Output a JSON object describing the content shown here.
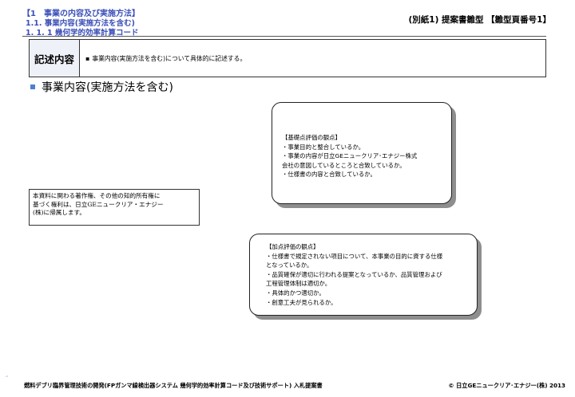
{
  "header": {
    "line1": "【1　事業の内容及び実施方法】",
    "line2": "1.1. 事業内容(実施方法を含む)",
    "line3": "1. 1. 1  幾何学的効率計算コード",
    "doc_label": "(別紙1) 提案書雛型 【雛型頁番号1】"
  },
  "summary": {
    "tag": "記述内容",
    "bullet": "▪",
    "text": "事業内容(実施方法を含む)について具体的に記述する。"
  },
  "section": {
    "heading": "事業内容(実施方法を含む)"
  },
  "callout_basic": {
    "lines": [
      "【基礎点評価の観点】",
      "・事業目的と整合しているか。",
      "・事業の内容が日立GEニュークリア･エナジー株式",
      "会社の意図しているところと合致しているか。",
      "・仕様書の内容と合致しているか。"
    ]
  },
  "callout_bonus": {
    "lines": [
      "【加点評価の観点】",
      "・仕様書で規定されない項目について、本事業の目的に資する仕様",
      "となっているか。",
      "・品質確保が適切に行われる提案となっているか、品質管理および",
      "工程管理体制は適切か。",
      "・具体的かつ適切か。",
      "・創意工夫が見られるか。"
    ]
  },
  "copyright_note": {
    "lines": [
      "本資料に関わる著作権、その他の知的所有権に",
      "基づく権利は、日立GEニュークリア・エナジー",
      "(株)に帰属します。"
    ]
  },
  "footer": {
    "left": "燃料デブリ臨界管理技術の開発(FPガンマ線検出器システム  幾何学的効率計算コード及び技術サポート)  入札提案書",
    "right": "© 日立GEニュークリア･エナジー(株) 2013",
    "mark": "⁻⁴"
  },
  "colors": {
    "header_text": "#3b4fb8",
    "section_bullet": "#4f7fd0",
    "callout_shadow": "#8e8e8e"
  }
}
